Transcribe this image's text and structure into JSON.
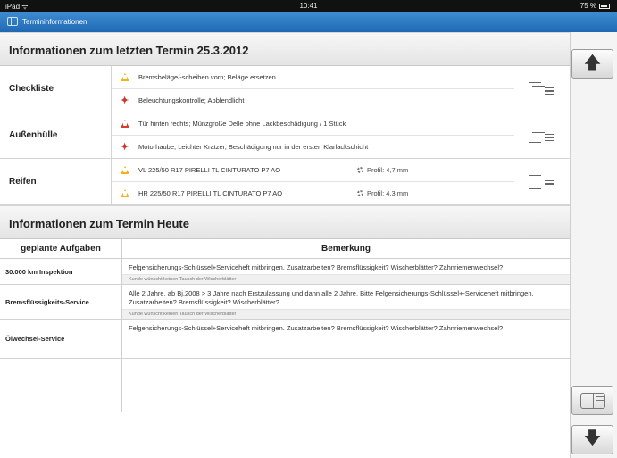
{
  "status": {
    "device": "iPad ᯤ",
    "time": "10:41",
    "battery": "75 %"
  },
  "nav": {
    "title": "Termininformationen"
  },
  "last": {
    "title": "Informationen zum letzten Termin 25.3.2012",
    "groups": [
      {
        "label": "Checkliste",
        "rows": [
          {
            "icon": "warning-yellow",
            "text": "Bremsbeläge/-scheiben vorn; Beläge ersetzen"
          },
          {
            "icon": "wrench-red",
            "text": "Beleuchtungskontrolle; Abblendlicht"
          }
        ]
      },
      {
        "label": "Außenhülle",
        "rows": [
          {
            "icon": "warning-red",
            "text": "Tür hinten rechts; Münzgroße Delle ohne Lackbeschädigung / 1 Stück"
          },
          {
            "icon": "wrench-red",
            "text": "Motorhaube; Leichter Kratzer, Beschädigung nur in der ersten Klarlackschicht"
          }
        ]
      },
      {
        "label": "Reifen",
        "rows": [
          {
            "icon": "warning-yellow",
            "text": "VL 225/50 R17 PIRELLI TL CINTURATO P7 AO",
            "profil": "Profil: 4,7 mm"
          },
          {
            "icon": "warning-yellow",
            "text": "HR 225/50 R17 PIRELLI TL CINTURATO P7 AO",
            "profil": "Profil: 4,3 mm"
          }
        ]
      }
    ]
  },
  "today": {
    "title": "Informationen zum Termin Heute",
    "col_task": "geplante Aufgaben",
    "col_remark": "Bemerkung",
    "tasks": [
      {
        "name": "30.000 km Inspektion",
        "text": "Felgensicherungs-Schlüssel+Serviceheft mitbringen. Zusatzarbeiten? Bremsflüssigkeit? Wischerblätter? Zahnriemenwechsel?",
        "note": "Kunde wünscht keinen Tausch der Wischerblätter"
      },
      {
        "name": "Bremsflüssigkeits-Service",
        "text": "Alle 2 Jahre, ab Bj.2008 > 3 Jahre nach Erstzulassung und dann alle 2 Jahre. Bitte Felgensicherungs-Schlüssel+-Serviceheft mitbringen. Zusatzarbeiten? Bremsflüssigkeit? Wischerblätter?",
        "note": "Kunde wünscht keinen Tausch der Wischerblätter"
      },
      {
        "name": "Ölwechsel-Service",
        "text": "Felgensicherungs-Schlüssel+Serviceheft mitbringen. Zusatzarbeiten? Bremsflüssigkeit? Wischerblätter? Zahnriemenwechsel?",
        "note": ""
      }
    ]
  },
  "side": {
    "up_icon": "arrow-up-icon",
    "panel_icon": "panel-icon",
    "down_icon": "arrow-down-icon"
  }
}
